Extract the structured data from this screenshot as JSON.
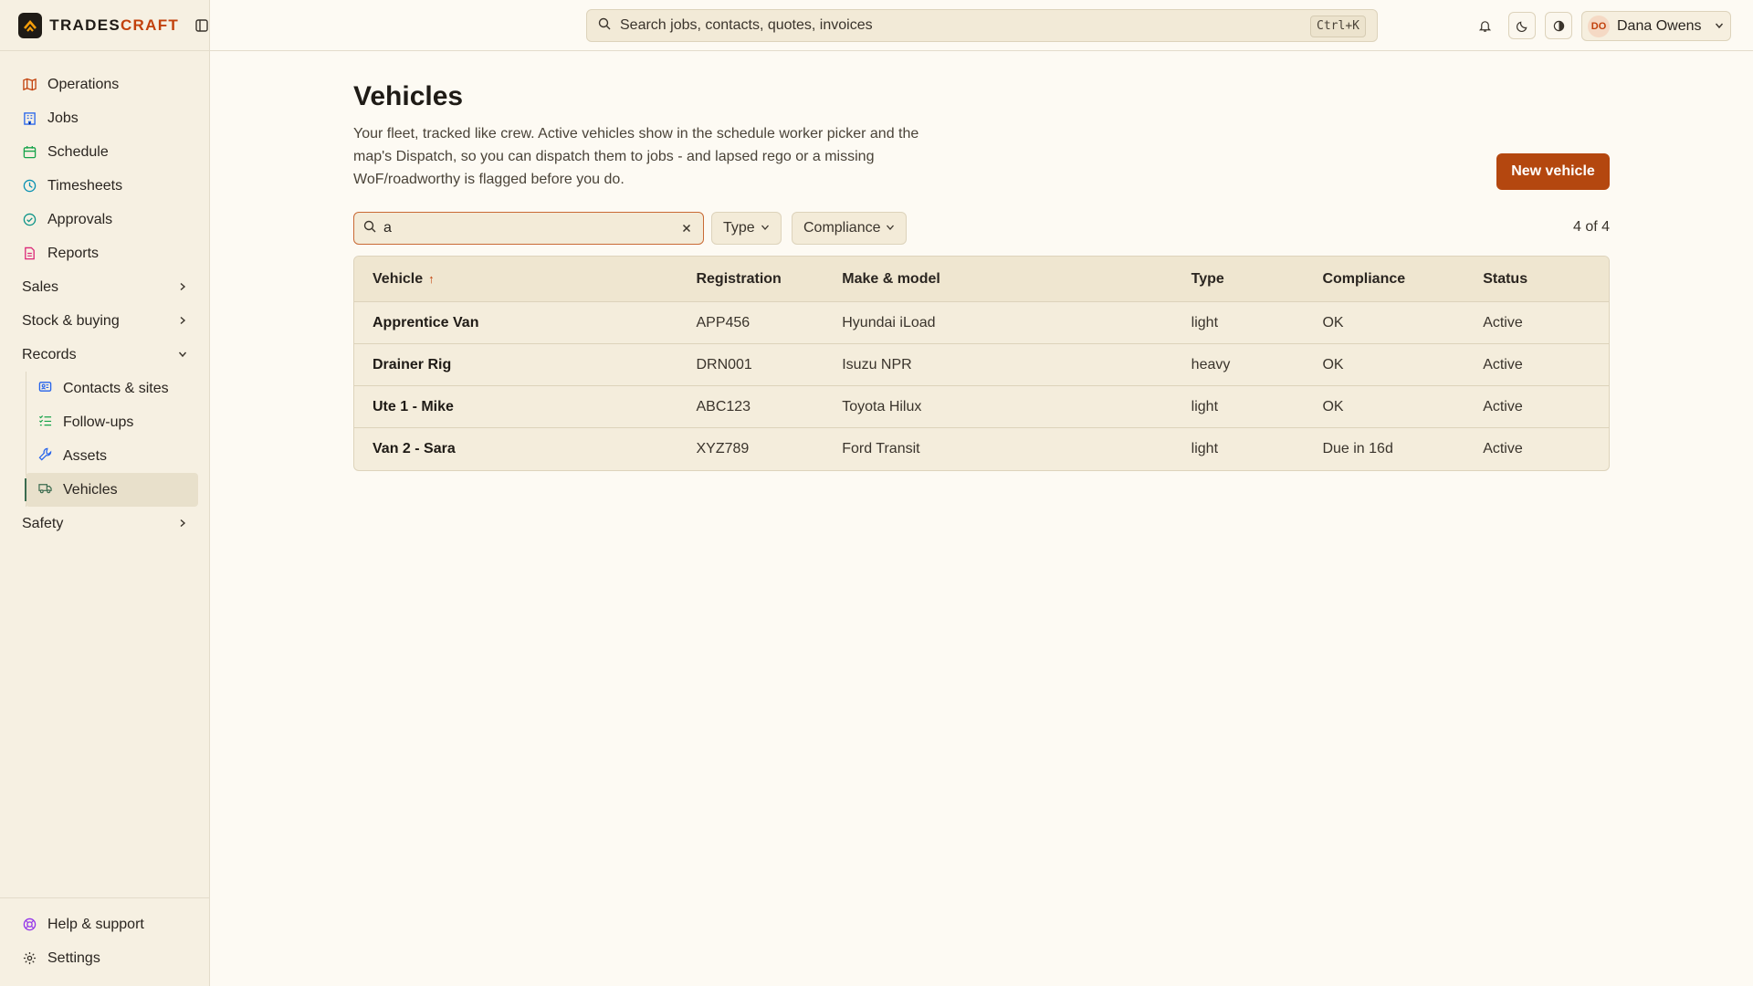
{
  "brand": {
    "name_part1": "TRADES",
    "name_part2": "CRAFT"
  },
  "sidebar": {
    "items": [
      {
        "label": "Operations",
        "icon": "map-icon",
        "color": "#c2410c"
      },
      {
        "label": "Jobs",
        "icon": "building-icon",
        "color": "#2563eb"
      },
      {
        "label": "Schedule",
        "icon": "calendar-icon",
        "color": "#16a34a"
      },
      {
        "label": "Timesheets",
        "icon": "clock-icon",
        "color": "#0891b2"
      },
      {
        "label": "Approvals",
        "icon": "check-circle-icon",
        "color": "#0d9488"
      },
      {
        "label": "Reports",
        "icon": "report-icon",
        "color": "#db2777"
      }
    ],
    "groups": {
      "sales": "Sales",
      "stock": "Stock & buying",
      "records": "Records",
      "safety": "Safety"
    },
    "records_items": [
      {
        "label": "Contacts & sites",
        "icon": "contacts-icon"
      },
      {
        "label": "Follow-ups",
        "icon": "list-check-icon"
      },
      {
        "label": "Assets",
        "icon": "wrench-icon"
      },
      {
        "label": "Vehicles",
        "icon": "truck-icon"
      }
    ],
    "footer": {
      "help": "Help & support",
      "settings": "Settings"
    }
  },
  "topbar": {
    "search_placeholder": "Search jobs, contacts, quotes, invoices",
    "shortcut": "Ctrl+K",
    "user_initials": "DO",
    "user_name": "Dana Owens"
  },
  "page": {
    "title": "Vehicles",
    "description": "Your fleet, tracked like crew. Active vehicles show in the schedule worker picker and the map's Dispatch, so you can dispatch them to jobs - and lapsed rego or a missing WoF/roadworthy is flagged before you do.",
    "new_button": "New vehicle",
    "search_value": "a",
    "filter_type": "Type",
    "filter_compliance": "Compliance",
    "count": "4 of 4"
  },
  "table": {
    "headers": [
      "Vehicle",
      "Registration",
      "Make & model",
      "Type",
      "Compliance",
      "Status"
    ],
    "rows": [
      [
        "Apprentice Van",
        "APP456",
        "Hyundai iLoad",
        "light",
        "OK",
        "Active"
      ],
      [
        "Drainer Rig",
        "DRN001",
        "Isuzu NPR",
        "heavy",
        "OK",
        "Active"
      ],
      [
        "Ute 1 - Mike",
        "ABC123",
        "Toyota Hilux",
        "light",
        "OK",
        "Active"
      ],
      [
        "Van 2 - Sara",
        "XYZ789",
        "Ford Transit",
        "light",
        "Due in 16d",
        "Active"
      ]
    ]
  },
  "colors": {
    "accent": "#b4470f",
    "active_bar": "#3b6b4f"
  }
}
